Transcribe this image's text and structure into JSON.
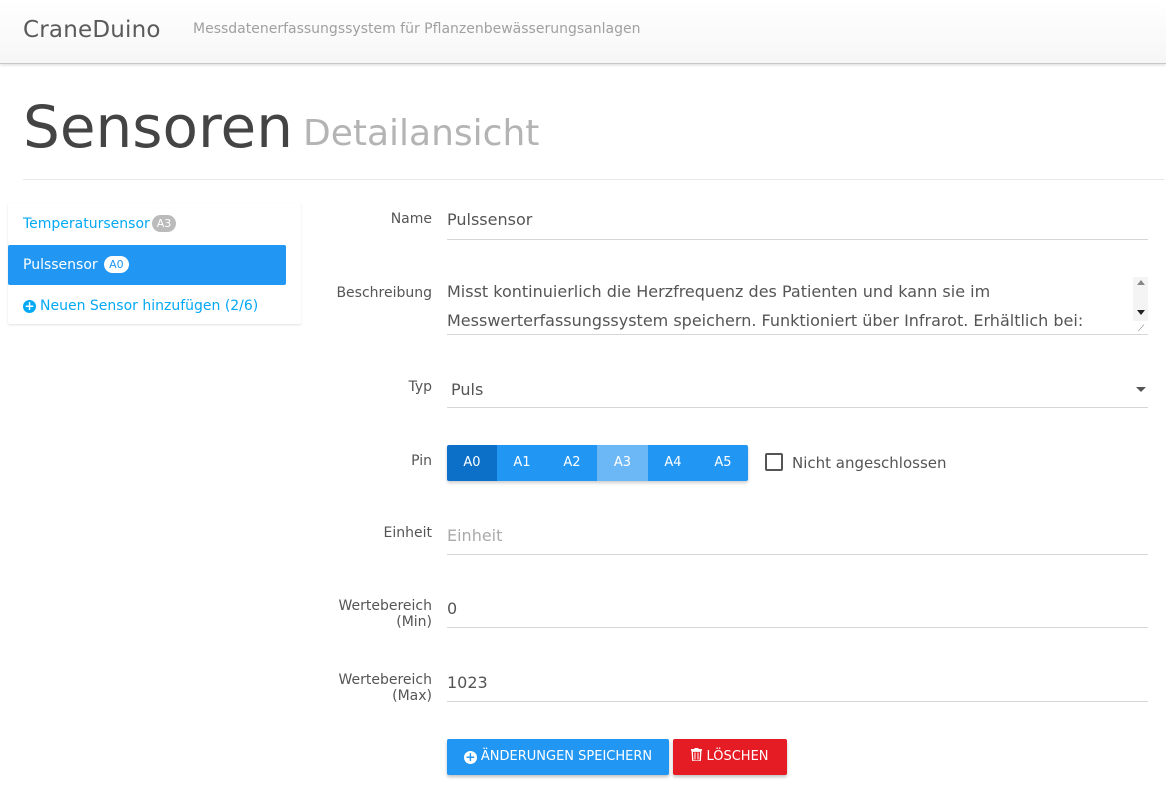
{
  "navbar": {
    "brand": "CraneDuino",
    "subtitle": "Messdatenerfassungssystem für Pflanzenbewässerungsanlagen"
  },
  "header": {
    "title": "Sensoren",
    "subtitle": "Detailansicht"
  },
  "sidebar": {
    "items": [
      {
        "label": "Temperatursensor",
        "badge": "A3"
      },
      {
        "label": "Pulssensor",
        "badge": "A0"
      }
    ],
    "add_label": "Neuen Sensor hinzufügen (2/6)"
  },
  "form": {
    "name": {
      "label": "Name",
      "value": "Pulssensor"
    },
    "beschreibung": {
      "label": "Beschreibung",
      "line1": "Misst kontinuierlich die Herzfrequenz des Patienten und kann sie im",
      "line2": "Messwerterfassungssystem speichern. Funktioniert über Infrarot. Erhältlich bei:"
    },
    "typ": {
      "label": "Typ",
      "value": "Puls"
    },
    "pin": {
      "label": "Pin",
      "options": [
        "A0",
        "A1",
        "A2",
        "A3",
        "A4",
        "A5"
      ],
      "selected": "A0",
      "disabled": "A3",
      "checkbox_label": "Nicht angeschlossen"
    },
    "einheit": {
      "label": "Einheit",
      "placeholder": "Einheit",
      "value": ""
    },
    "min": {
      "label_line1": "Wertebereich",
      "label_line2": "(Min)",
      "value": "0"
    },
    "max": {
      "label_line1": "Wertebereich",
      "label_line2": "(Max)",
      "value": "1023"
    }
  },
  "buttons": {
    "save": "ÄNDERUNGEN SPEICHERN",
    "delete": "LÖSCHEN"
  },
  "colors": {
    "primary": "#2196f3",
    "primary_active": "#0d70c8",
    "link": "#03a9f4",
    "danger": "#e51c23"
  }
}
